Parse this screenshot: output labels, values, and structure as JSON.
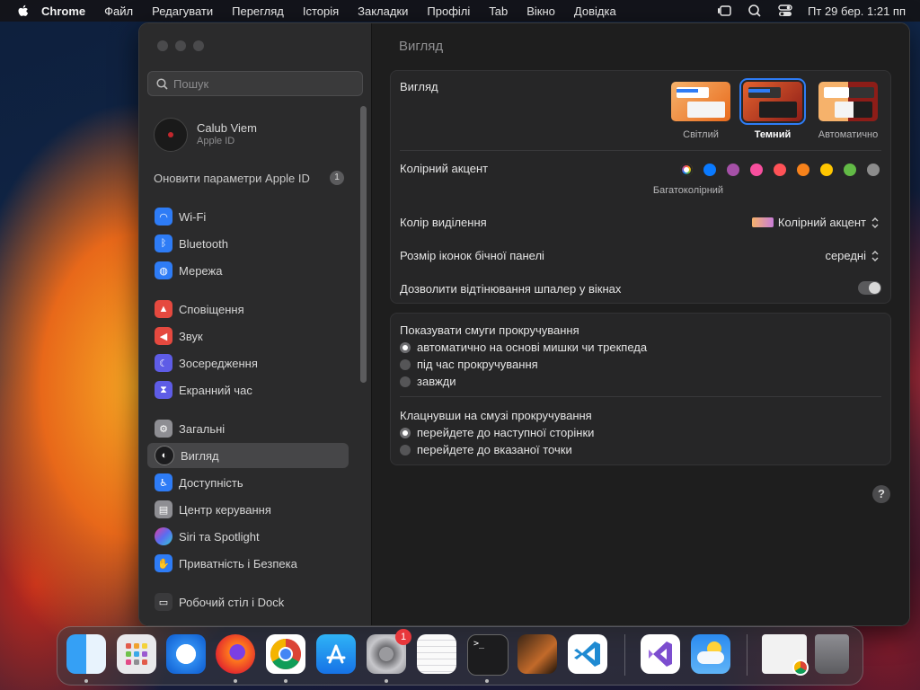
{
  "menubar": {
    "app": "Chrome",
    "items": [
      "Файл",
      "Редагувати",
      "Перегляд",
      "Історія",
      "Закладки",
      "Профілі",
      "Tab",
      "Вікно",
      "Довідка"
    ],
    "clock": "Пт 29 бер.  1:21 пп"
  },
  "sidebar": {
    "search_placeholder": "Пошук",
    "account_name": "Calub Viem",
    "account_sub": "Apple ID",
    "update_label": "Оновити параметри Apple ID",
    "update_badge": "1",
    "items": [
      {
        "label": "Wi-Fi",
        "icon": "wifi-icon",
        "color": "#2e7cf6"
      },
      {
        "label": "Bluetooth",
        "icon": "bluetooth-icon",
        "color": "#2e7cf6"
      },
      {
        "label": "Мережа",
        "icon": "globe-icon",
        "color": "#2e7cf6"
      },
      {
        "label": "Сповіщення",
        "icon": "bell-icon",
        "color": "#e5493f"
      },
      {
        "label": "Звук",
        "icon": "speaker-icon",
        "color": "#e5493f"
      },
      {
        "label": "Зосередження",
        "icon": "moon-icon",
        "color": "#5e5ce6"
      },
      {
        "label": "Екранний час",
        "icon": "hourglass-icon",
        "color": "#5e5ce6"
      },
      {
        "label": "Загальні",
        "icon": "gear-icon",
        "color": "#8e8e93"
      },
      {
        "label": "Вигляд",
        "icon": "appearance-icon",
        "color": "#1c1c1e"
      },
      {
        "label": "Доступність",
        "icon": "accessibility-icon",
        "color": "#2e7cf6"
      },
      {
        "label": "Центр керування",
        "icon": "control-center-icon",
        "color": "#8e8e93"
      },
      {
        "label": "Siri та Spotlight",
        "icon": "siri-icon",
        "color": "#b14fd8"
      },
      {
        "label": "Приватність і Безпека",
        "icon": "hand-icon",
        "color": "#2e7cf6"
      },
      {
        "label": "Робочий стіл і Dock",
        "icon": "dock-icon",
        "color": "#3a3a3c"
      }
    ]
  },
  "content": {
    "title": "Вигляд",
    "appearance_label": "Вигляд",
    "appearance_options": [
      "Світлий",
      "Темний",
      "Автоматично"
    ],
    "appearance_selected": "Темний",
    "accent_label": "Колірний акцент",
    "accent_caption": "Багатоколірний",
    "accent_colors": [
      "multicolor",
      "#0a7aff",
      "#a550a7",
      "#f74f9e",
      "#ff5257",
      "#f7821b",
      "#ffc600",
      "#62ba46",
      "#8c8c8c"
    ],
    "highlight_label": "Колір виділення",
    "highlight_value": "Колірний акцент",
    "sidebar_icon_label": "Розмір іконок бічної панелі",
    "sidebar_icon_value": "середні",
    "tinting_label": "Дозволити відтінювання шпалер у вікнах",
    "tinting_on": false,
    "scroll_label": "Показувати смуги прокручування",
    "scroll_options": [
      "автоматично на основі мишки чи трекпеда",
      "під час прокручування",
      "завжди"
    ],
    "scroll_selected": 0,
    "click_label": "Клацнувши на смузі прокручування",
    "click_options": [
      "перейдете до наступної сторінки",
      "перейдете до вказаної точки"
    ],
    "click_selected": 0,
    "help": "?"
  },
  "dock": {
    "apps": [
      "finder-icon",
      "launchpad-icon",
      "safari-icon",
      "firefox-icon",
      "chrome-icon",
      "app-store-icon",
      "system-settings-icon",
      "textedit-icon",
      "terminal-icon",
      "garageband-icon",
      "vscode-icon",
      "visual-studio-icon",
      "weather-icon",
      "chrome-window-icon",
      "trash-icon"
    ],
    "settings_badge": "1"
  }
}
